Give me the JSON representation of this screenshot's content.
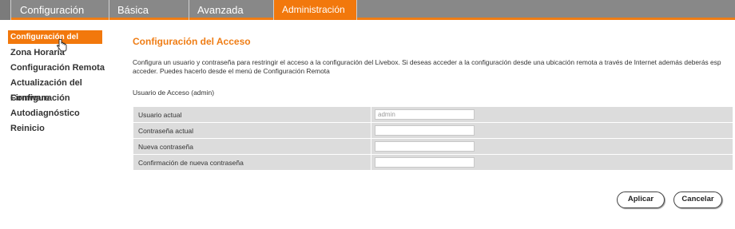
{
  "nav": {
    "tabs": [
      {
        "label": "Configuración rápida"
      },
      {
        "label": "Básica"
      },
      {
        "label": "Avanzada"
      },
      {
        "label": "Administración"
      }
    ],
    "active_color": "#f2780c"
  },
  "sidebar": {
    "items": [
      {
        "label": "Configuración del Acceso"
      },
      {
        "label": "Zona Horaria"
      },
      {
        "label": "Configuración Remota"
      },
      {
        "label": "Actualización del Firmware"
      },
      {
        "label": "Configuración"
      },
      {
        "label": "Autodiagnóstico"
      },
      {
        "label": "Reinicio"
      }
    ]
  },
  "main": {
    "title": "Configuración del Acceso",
    "description": "Configura un usuario y contraseña para restringir el acceso a la configuración del Livebox. Si deseas acceder a la configuración desde una ubicación remota a través de Internet además deberás esp acceder. Puedes hacerlo desde el menú de Configuración Remota",
    "section_label": "Usuario de Acceso (admin)"
  },
  "form": {
    "rows": [
      {
        "label": "Usuario actual",
        "value": "admin"
      },
      {
        "label": "Contraseña actual",
        "value": ""
      },
      {
        "label": "Nueva contraseña",
        "value": ""
      },
      {
        "label": "Confirmación de nueva contraseña",
        "value": ""
      }
    ]
  },
  "buttons": {
    "apply": "Aplicar",
    "cancel": "Cancelar"
  }
}
